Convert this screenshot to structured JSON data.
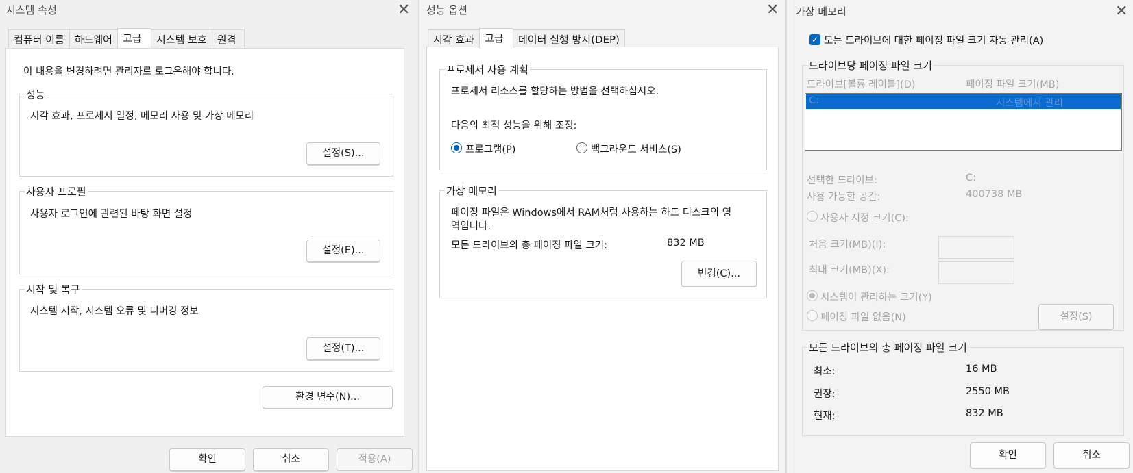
{
  "sysprops": {
    "title": "시스템 속성",
    "tabs": [
      "컴퓨터 이름",
      "하드웨어",
      "고급",
      "시스템 보호",
      "원격"
    ],
    "admin_note": "이 내용을 변경하려면 관리자로 로그온해야 합니다.",
    "perf": {
      "legend": "성능",
      "desc": "시각 효과, 프로세서 일정, 메모리 사용 및 가상 메모리",
      "button": "설정(S)..."
    },
    "profile": {
      "legend": "사용자 프로필",
      "desc": "사용자 로그인에 관련된 바탕 화면 설정",
      "button": "설정(E)..."
    },
    "startup": {
      "legend": "시작 및 복구",
      "desc": "시스템 시작, 시스템 오류 및 디버깅 정보",
      "button": "설정(T)..."
    },
    "env_button": "환경 변수(N)...",
    "ok": "확인",
    "cancel": "취소",
    "apply": "적용(A)"
  },
  "perfopts": {
    "title": "성능 옵션",
    "tabs": [
      "시각 효과",
      "고급",
      "데이터 실행 방지(DEP)"
    ],
    "sched": {
      "legend": "프로세서 사용 계획",
      "desc": "프로세서 리소스를 할당하는 방법을 선택하십시오.",
      "adjust": "다음의 최적 성능을 위해 조정:",
      "opt_programs": "프로그램(P)",
      "opt_background": "백그라운드 서비스(S)"
    },
    "vm": {
      "legend": "가상 메모리",
      "desc_line1": "페이징 파일은 Windows에서 RAM처럼 사용하는 하드 디스크의 영",
      "desc_line2": "역입니다.",
      "total_label": "모든 드라이브의 총 페이징 파일 크기:",
      "total_value": "832 MB",
      "change_button": "변경(C)..."
    }
  },
  "vmem": {
    "title": "가상 메모리",
    "auto_manage": "모든 드라이브에 대한 페이징 파일 크기 자동 관리(A)",
    "per_drive_legend": "드라이브당 페이징 파일 크기",
    "col_drive": "드라이브[볼륨 레이블](D)",
    "col_size": "페이징 파일 크기(MB)",
    "row_drive": "C:",
    "row_size": "시스템에서 관리",
    "selected_drive_label": "선택한 드라이브:",
    "selected_drive_value": "C:",
    "free_space_label": "사용 가능한 공간:",
    "free_space_value": "400738 MB",
    "custom_size": "사용자 지정 크기(C):",
    "initial_size": "처음 크기(MB)(I):",
    "max_size": "최대 크기(MB)(X):",
    "system_managed": "시스템이 관리하는 크기(Y)",
    "no_paging": "페이징 파일 없음(N)",
    "set_button": "설정(S)",
    "total_legend": "모든 드라이브의 총 페이징 파일 크기",
    "min_label": "최소:",
    "min_value": "16 MB",
    "rec_label": "권장:",
    "rec_value": "2550 MB",
    "cur_label": "현재:",
    "cur_value": "832 MB",
    "ok": "확인",
    "cancel": "취소"
  }
}
